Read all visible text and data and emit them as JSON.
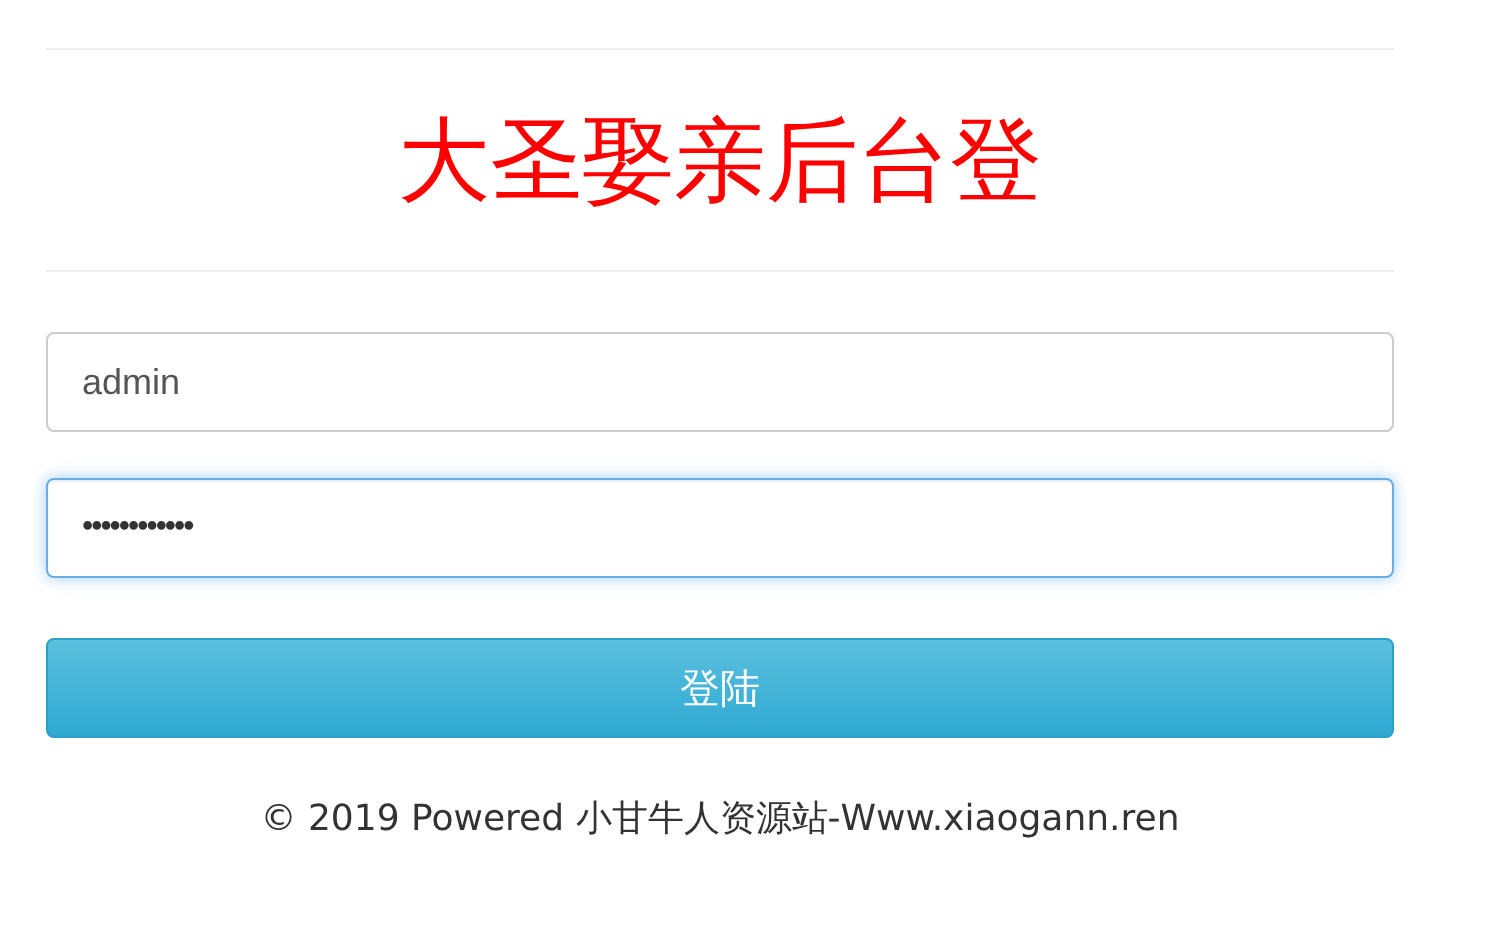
{
  "title": "大圣娶亲后台登",
  "fields": [
    {
      "kind": "text",
      "value": "admin",
      "focused": false
    },
    {
      "kind": "password",
      "value": "••••••••••••",
      "focused": true
    }
  ],
  "login_button": "登陆",
  "footer": "© 2019 Powered 小甘牛人资源站-Www.xiaogann.ren"
}
